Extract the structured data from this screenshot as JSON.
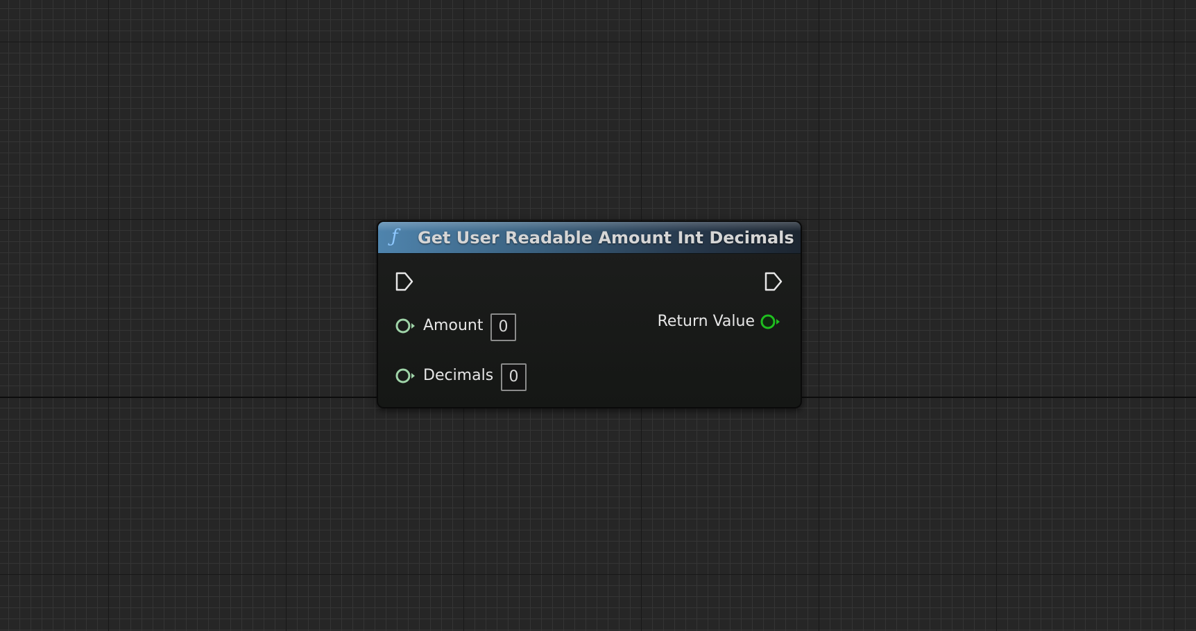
{
  "graph": {
    "background_color": "#262626"
  },
  "node": {
    "icon": "function-icon",
    "icon_glyph": "ƒ",
    "title": "Get User Readable Amount Int Decimals",
    "header_color": "#4f84ad",
    "exec_in": {
      "icon": "exec-pin-icon"
    },
    "exec_out": {
      "icon": "exec-pin-icon"
    },
    "inputs": [
      {
        "label": "Amount",
        "value": "0",
        "pin_color": "#9fd4a8",
        "icon": "integer-pin-icon"
      },
      {
        "label": "Decimals",
        "value": "0",
        "pin_color": "#9fd4a8",
        "icon": "integer-pin-icon"
      }
    ],
    "outputs": [
      {
        "label": "Return Value",
        "pin_color": "#1fbf1f",
        "icon": "integer-pin-icon"
      }
    ]
  }
}
